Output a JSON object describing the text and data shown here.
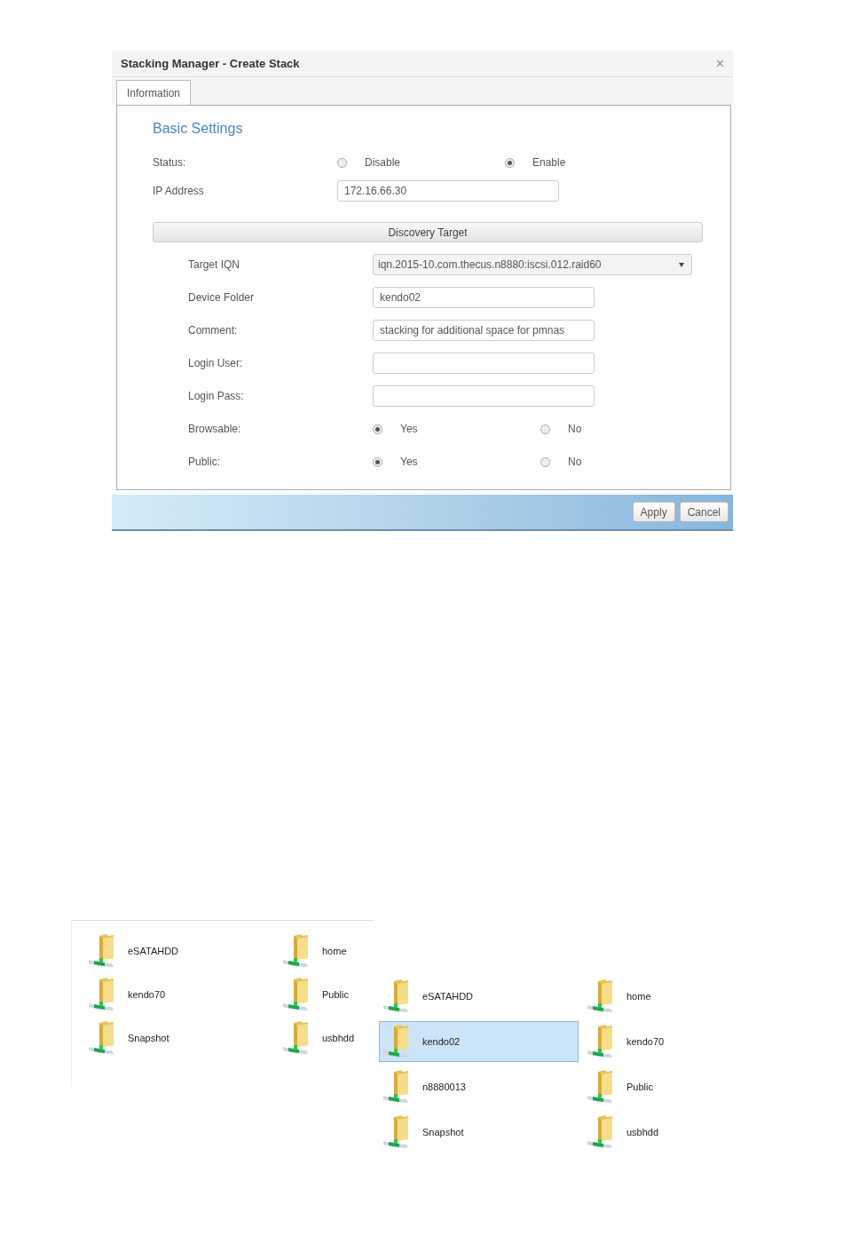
{
  "dialog": {
    "title": "Stacking Manager - Create Stack",
    "close": "×",
    "tabs": [
      {
        "label": "Information",
        "selected": true
      }
    ],
    "section_title": "Basic Settings",
    "settings": [
      {
        "kind": "radio",
        "label": "Status:",
        "options": [
          {
            "label": "Disable",
            "selected": false
          },
          {
            "label": "Enable",
            "selected": true
          }
        ]
      },
      {
        "kind": "text",
        "label": "IP Address",
        "value": "172.16.66.30"
      }
    ],
    "discovery_header": "Discovery Target",
    "target_fields": [
      {
        "kind": "select",
        "label": "Target IQN",
        "value": "iqn.2015-10.com.thecus.n8880:iscsi.012.raid60"
      },
      {
        "kind": "text",
        "label": "Device Folder",
        "value": "kendo02"
      },
      {
        "kind": "text",
        "label": "Comment:",
        "value": "stacking for additional space for pmnas"
      },
      {
        "kind": "text",
        "label": "Login User:"
      },
      {
        "kind": "text",
        "label": "Login Pass:"
      },
      {
        "kind": "radio",
        "label": "Browsable:",
        "options": [
          {
            "label": "Yes",
            "selected": true
          },
          {
            "label": "No",
            "selected": false
          }
        ]
      },
      {
        "kind": "radio",
        "label": "Public:",
        "options": [
          {
            "label": "Yes",
            "selected": true
          },
          {
            "label": "No",
            "selected": false
          }
        ]
      }
    ],
    "buttons": [
      "Apply",
      "Cancel"
    ]
  },
  "share_views": [
    {
      "items": [
        {
          "name": "eSATAHDD",
          "selected": false
        },
        {
          "name": "home",
          "selected": false
        },
        {
          "name": "kendo70",
          "selected": false
        },
        {
          "name": "Public",
          "selected": false
        },
        {
          "name": "Snapshot",
          "selected": false
        },
        {
          "name": "usbhdd",
          "selected": false
        }
      ]
    },
    {
      "items": [
        {
          "name": "eSATAHDD",
          "selected": false
        },
        {
          "name": "home",
          "selected": false
        },
        {
          "name": "kendo02",
          "selected": true
        },
        {
          "name": "kendo70",
          "selected": false
        },
        {
          "name": "n8880013",
          "selected": false
        },
        {
          "name": "Public",
          "selected": false
        },
        {
          "name": "Snapshot",
          "selected": false
        },
        {
          "name": "usbhdd",
          "selected": false
        }
      ]
    }
  ]
}
